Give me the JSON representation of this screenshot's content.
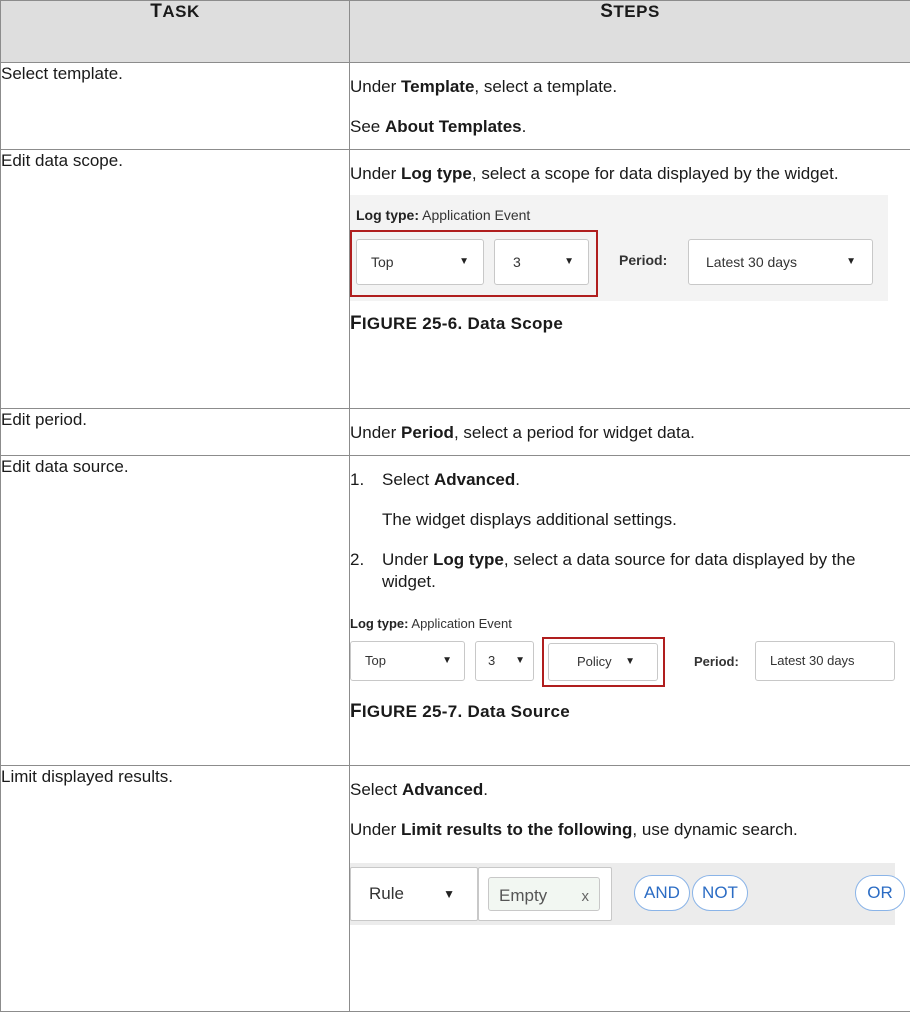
{
  "headers": {
    "task": "Task",
    "steps": "Steps"
  },
  "rows": {
    "r1": {
      "task": "Select template.",
      "l1_pre": "Under ",
      "l1_bold": "Template",
      "l1_post": ", select a template.",
      "l2_pre": "See ",
      "l2_bold": "About Templates",
      "l2_post": "."
    },
    "r2": {
      "task": "Edit data scope.",
      "l1_pre": "Under ",
      "l1_bold": "Log type",
      "l1_post": ", select a scope for data displayed by the widget.",
      "figure": {
        "log_label": "Log type:",
        "log_value": "Application Event",
        "dd1": "Top",
        "dd2": "3",
        "period_label": "Period:",
        "period_value": "Latest 30 days"
      },
      "caption": "Figure 25-6. Data Scope"
    },
    "r3": {
      "task": "Edit period.",
      "l1_pre": "Under ",
      "l1_bold": "Period",
      "l1_post": ", select a period for widget data."
    },
    "r4": {
      "task": "Edit data source.",
      "s1_num": "1.",
      "s1_pre": "Select ",
      "s1_bold": "Advanced",
      "s1_post": ".",
      "s1_sub": "The widget displays additional settings.",
      "s2_num": "2.",
      "s2_pre": "Under ",
      "s2_bold": "Log type",
      "s2_post": ", select a data source for data displayed by the widget.",
      "figure": {
        "log_label": "Log type:",
        "log_value": "Application Event",
        "dd1": "Top",
        "dd2": "3",
        "dd3": "Policy",
        "period_label": "Period:",
        "period_value": "Latest 30 days"
      },
      "caption": "Figure 25-7. Data Source"
    },
    "r5": {
      "task": "Limit displayed results.",
      "l1_pre": "Select ",
      "l1_bold": "Advanced",
      "l1_post": ".",
      "l2_pre": "Under ",
      "l2_bold": "Limit results to the following",
      "l2_post": ", use dynamic search.",
      "widget": {
        "rule": "Rule",
        "empty": "Empty",
        "and": "AND",
        "not": "NOT",
        "or": "OR"
      }
    }
  },
  "colors": {
    "highlight_border": "#b01e1e",
    "header_bg": "#dedede",
    "pill_text": "#2b6cc4"
  },
  "icons": {
    "dropdown": "triangle-down-icon",
    "remove": "close-x-icon"
  }
}
